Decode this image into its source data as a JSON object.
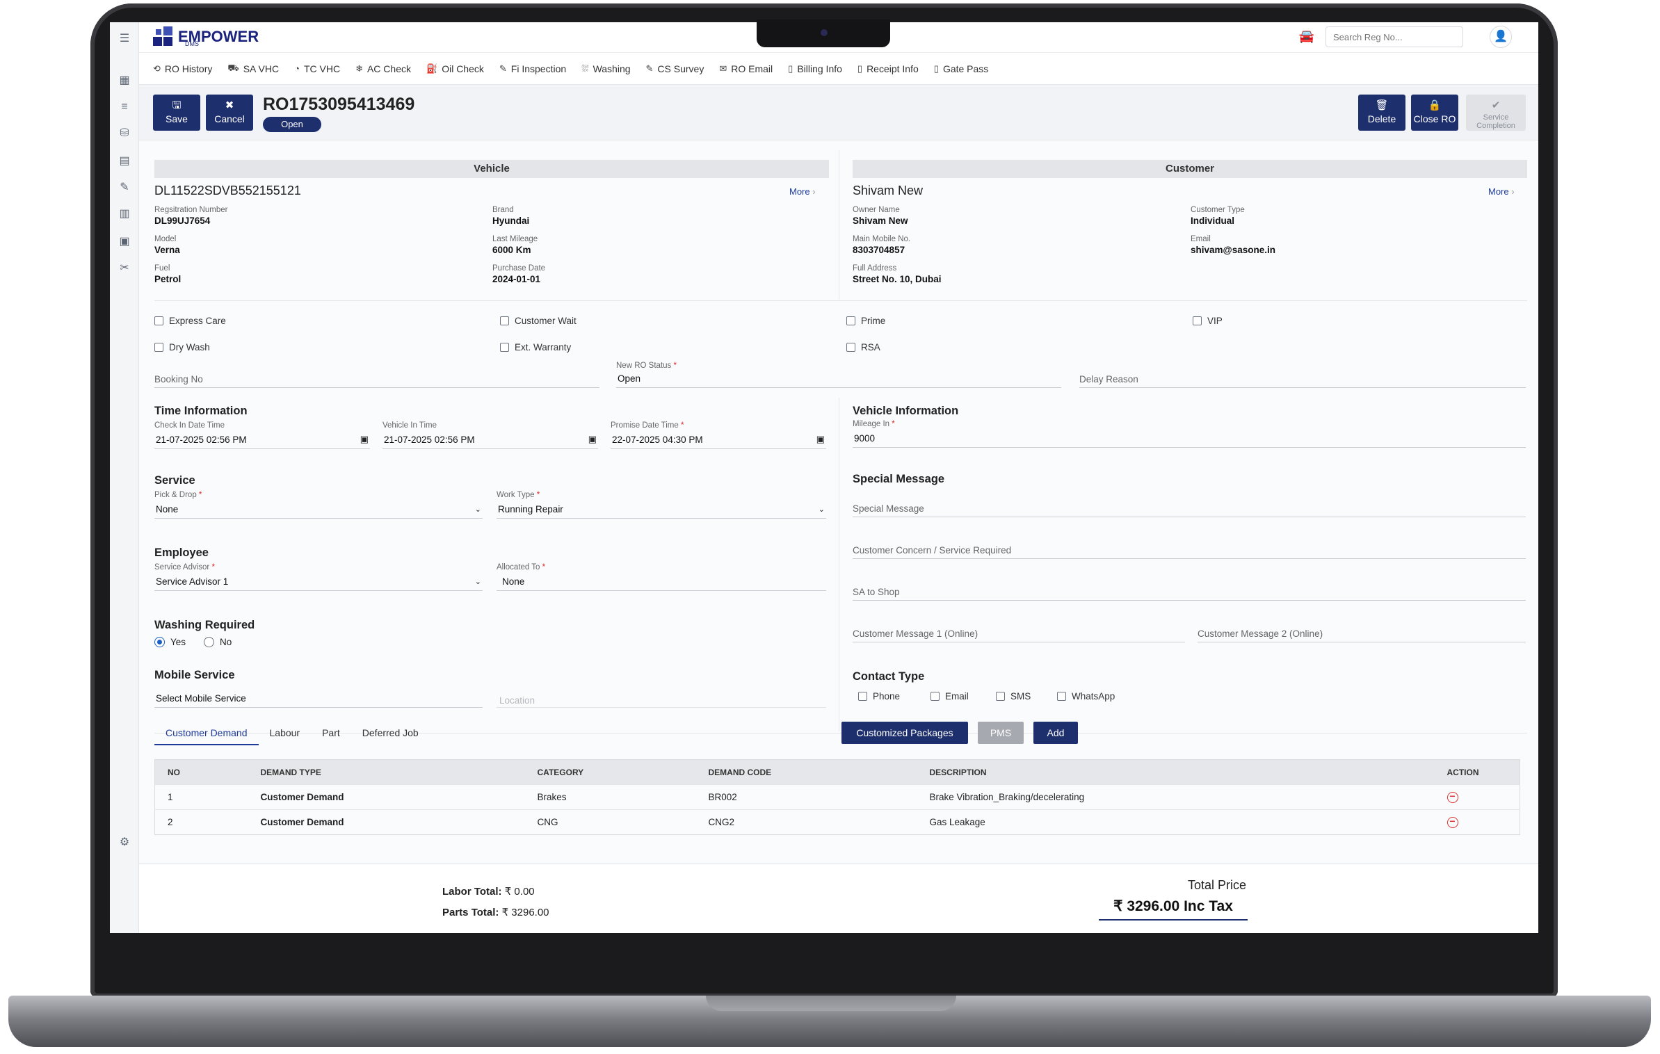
{
  "app": {
    "logo_text": "EMPOWER",
    "logo_sub": "DMS",
    "search_placeholder": "Search Reg No..."
  },
  "nav": [
    {
      "label": "RO History",
      "icon": "history-icon"
    },
    {
      "label": "SA VHC",
      "icon": "car-check-icon"
    },
    {
      "label": "TC VHC",
      "icon": "gauge-icon"
    },
    {
      "label": "AC Check",
      "icon": "ac-icon"
    },
    {
      "label": "Oil Check",
      "icon": "oil-icon"
    },
    {
      "label": "Fi Inspection",
      "icon": "edit-icon"
    },
    {
      "label": "Washing",
      "icon": "wash-icon"
    },
    {
      "label": "CS Survey",
      "icon": "survey-icon"
    },
    {
      "label": "RO Email",
      "icon": "email-icon"
    },
    {
      "label": "Billing Info",
      "icon": "billing-icon"
    },
    {
      "label": "Receipt Info",
      "icon": "receipt-icon"
    },
    {
      "label": "Gate Pass",
      "icon": "gatepass-icon"
    }
  ],
  "actions": {
    "save": "Save",
    "cancel": "Cancel",
    "ro_number": "RO1753095413469",
    "ro_status": "Open",
    "delete": "Delete",
    "close_ro": "Close RO",
    "service_completion": "Service Completion"
  },
  "vehicle": {
    "header": "Vehicle",
    "vin": "DL11522SDVB552155121",
    "more": "More",
    "reg_label": "Regsitration Number",
    "reg": "DL99UJ7654",
    "model_label": "Model",
    "model": "Verna",
    "fuel_label": "Fuel",
    "fuel": "Petrol",
    "brand_label": "Brand",
    "brand": "Hyundai",
    "mileage_label": "Last Mileage",
    "mileage": "6000 Km",
    "purchase_label": "Purchase Date",
    "purchase": "2024-01-01"
  },
  "customer": {
    "header": "Customer",
    "name": "Shivam New",
    "more": "More",
    "owner_label": "Owner Name",
    "owner": "Shivam New",
    "mobile_label": "Main Mobile No.",
    "mobile": "8303704857",
    "address_label": "Full Address",
    "address": "Street No. 10, Dubai",
    "type_label": "Customer Type",
    "type": "Individual",
    "email_label": "Email",
    "email": "shivam@sasone.in"
  },
  "flags": {
    "express_care": "Express Care",
    "customer_wait": "Customer Wait",
    "prime": "Prime",
    "vip": "VIP",
    "dry_wash": "Dry Wash",
    "ext_warranty": "Ext. Warranty",
    "rsa": "RSA"
  },
  "booking": {
    "booking_no": "Booking No",
    "status_label": "New RO Status",
    "status": "Open",
    "delay_reason": "Delay Reason"
  },
  "time": {
    "title": "Time Information",
    "checkin_label": "Check In Date Time",
    "checkin": "21-07-2025 02:56 PM",
    "vehicle_in_label": "Vehicle In Time",
    "vehicle_in": "21-07-2025 02:56 PM",
    "promise_label": "Promise Date Time",
    "promise": "22-07-2025 04:30 PM"
  },
  "service": {
    "title": "Service",
    "pick_label": "Pick & Drop",
    "pick": "None",
    "work_label": "Work Type",
    "work": "Running Repair"
  },
  "employee": {
    "title": "Employee",
    "advisor_label": "Service Advisor",
    "advisor": "Service Advisor 1",
    "allocated_label": "Allocated To",
    "allocated": "None"
  },
  "washing": {
    "title": "Washing Required",
    "yes": "Yes",
    "no": "No"
  },
  "mobile_service": {
    "title": "Mobile Service",
    "select": "Select Mobile Service",
    "location": "Location"
  },
  "vehicle_info": {
    "title": "Vehicle Information",
    "mileage_label": "Mileage In",
    "mileage": "9000"
  },
  "special": {
    "title": "Special Message",
    "special_ph": "Special Message",
    "concern_ph": "Customer Concern / Service Required",
    "sa_shop_ph": "SA to Shop",
    "msg1_ph": "Customer Message 1 (Online)",
    "msg2_ph": "Customer Message 2 (Online)"
  },
  "contact": {
    "title": "Contact Type",
    "phone": "Phone",
    "email": "Email",
    "sms": "SMS",
    "whatsapp": "WhatsApp"
  },
  "tabs": [
    "Customer Demand",
    "Labour",
    "Part",
    "Deferred Job"
  ],
  "buttons": {
    "packages": "Customized Packages",
    "pms": "PMS",
    "add": "Add"
  },
  "table": {
    "headers": [
      "NO",
      "DEMAND TYPE",
      "CATEGORY",
      "DEMAND CODE",
      "DESCRIPTION",
      "ACTION"
    ],
    "rows": [
      [
        "1",
        "Customer Demand",
        "Brakes",
        "BR002",
        "Brake Vibration_Braking/decelerating"
      ],
      [
        "2",
        "Customer Demand",
        "CNG",
        "CNG2",
        "Gas Leakage"
      ]
    ]
  },
  "totals": {
    "labor_label": "Labor Total:",
    "labor": "₹ 0.00",
    "parts_label": "Parts Total:",
    "parts": "₹ 3296.00",
    "total_label": "Total Price",
    "total": "₹ 3296.00 Inc Tax"
  }
}
